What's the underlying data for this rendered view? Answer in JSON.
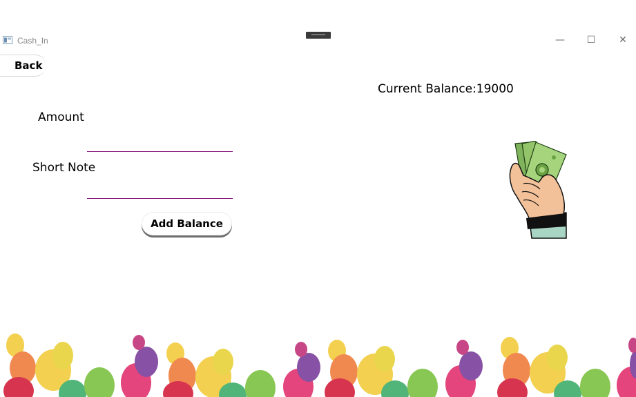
{
  "window": {
    "title": "Cash_In",
    "icon": "app-window-icon",
    "controls": {
      "minimize": "—",
      "maximize": "☐",
      "close": "✕"
    }
  },
  "nav": {
    "back_label": "Back"
  },
  "form": {
    "amount_label": "Amount",
    "amount_value": "",
    "note_label": "Short Note",
    "note_value": "",
    "submit_label": "Add Balance"
  },
  "balance": {
    "text": "Current Balance:19000"
  },
  "illustration": {
    "icon": "money-hand-icon"
  },
  "decor": {
    "icon": "balloons-decoration"
  },
  "colors": {
    "field_underline": "#8a1a7e",
    "balloon_red": "#d21f3c",
    "balloon_orange": "#ef7d3c",
    "balloon_yellow": "#f2cc3d",
    "balloon_green": "#7cc242",
    "balloon_magenta": "#e0316e",
    "balloon_purple": "#7b3f9c"
  }
}
